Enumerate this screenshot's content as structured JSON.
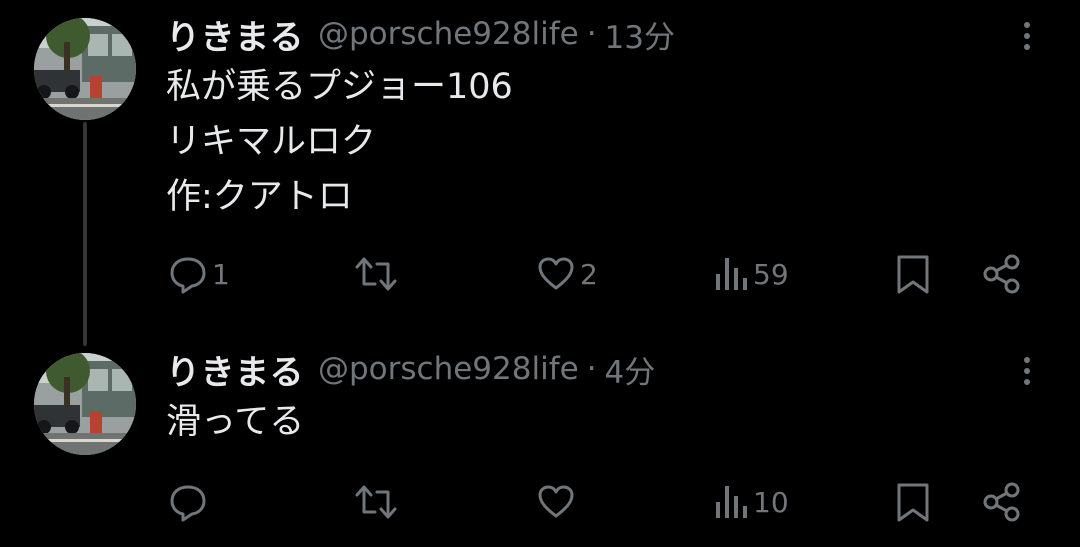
{
  "thread": {
    "tweets": [
      {
        "display_name": "りきまる",
        "handle": "@porsche928life",
        "separator": "·",
        "time": "13分",
        "avatar_icon": "avatar-photo-icon",
        "lines": [
          "私が乗るプジョー106",
          "リキマルロク",
          "作:クアトロ"
        ],
        "actions": {
          "reply_count": "1",
          "retweet_count": "",
          "like_count": "2",
          "views_count": "59"
        }
      },
      {
        "display_name": "りきまる",
        "handle": "@porsche928life",
        "separator": "·",
        "time": "4分",
        "avatar_icon": "avatar-photo-icon",
        "lines": [
          "滑ってる"
        ],
        "actions": {
          "reply_count": "",
          "retweet_count": "",
          "like_count": "",
          "views_count": "10"
        }
      }
    ]
  },
  "colors": {
    "background": "#000000",
    "primary_text": "#e7e9ea",
    "secondary_text": "#71767b",
    "thread_line": "#333639"
  },
  "icons": [
    "more-icon",
    "reply-icon",
    "retweet-icon",
    "like-icon",
    "views-icon",
    "bookmark-icon",
    "share-icon"
  ]
}
